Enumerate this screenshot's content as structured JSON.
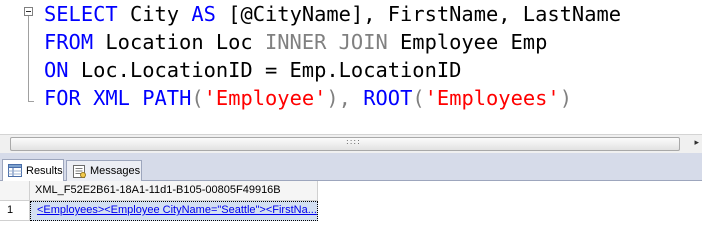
{
  "editor": {
    "lines": [
      [
        {
          "t": "SELECT",
          "c": "kw"
        },
        {
          "t": " City ",
          "c": ""
        },
        {
          "t": "AS",
          "c": "kw"
        },
        {
          "t": " [@CityName], FirstName, LastName",
          "c": ""
        }
      ],
      [
        {
          "t": "FROM",
          "c": "kw"
        },
        {
          "t": " Location Loc ",
          "c": ""
        },
        {
          "t": "INNER JOIN",
          "c": "gray"
        },
        {
          "t": " Employee Emp",
          "c": ""
        }
      ],
      [
        {
          "t": "ON",
          "c": "kw"
        },
        {
          "t": " Loc.LocationID = Emp.LocationID",
          "c": ""
        }
      ],
      [
        {
          "t": "FOR",
          "c": "kw"
        },
        {
          "t": " ",
          "c": ""
        },
        {
          "t": "XML",
          "c": "kw"
        },
        {
          "t": " ",
          "c": ""
        },
        {
          "t": "PATH",
          "c": "kw"
        },
        {
          "t": "(",
          "c": "gray"
        },
        {
          "t": "'Employee'",
          "c": "str"
        },
        {
          "t": "),",
          "c": "gray"
        },
        {
          "t": " ",
          "c": ""
        },
        {
          "t": "ROOT",
          "c": "kw"
        },
        {
          "t": "(",
          "c": "gray"
        },
        {
          "t": "'Employees'",
          "c": "str"
        },
        {
          "t": ")",
          "c": "gray"
        }
      ]
    ]
  },
  "scrollbar": {
    "grip": "::::",
    "arrow": "▸"
  },
  "tabs": [
    {
      "label": "Results",
      "icon": "results-grid-icon",
      "active": true
    },
    {
      "label": "Messages",
      "icon": "messages-icon",
      "active": false
    }
  ],
  "results": {
    "column_header": "XML_F52E2B61-18A1-11d1-B105-00805F49916B",
    "rows": [
      {
        "num": "1",
        "value": "<Employees><Employee CityName=\"Seattle\"><FirstNa..."
      }
    ]
  },
  "colors": {
    "keyword": "#0000ff",
    "operator": "#808080",
    "string": "#ff0000",
    "selected_cell": "#d3dff2",
    "link": "#0000ee"
  }
}
